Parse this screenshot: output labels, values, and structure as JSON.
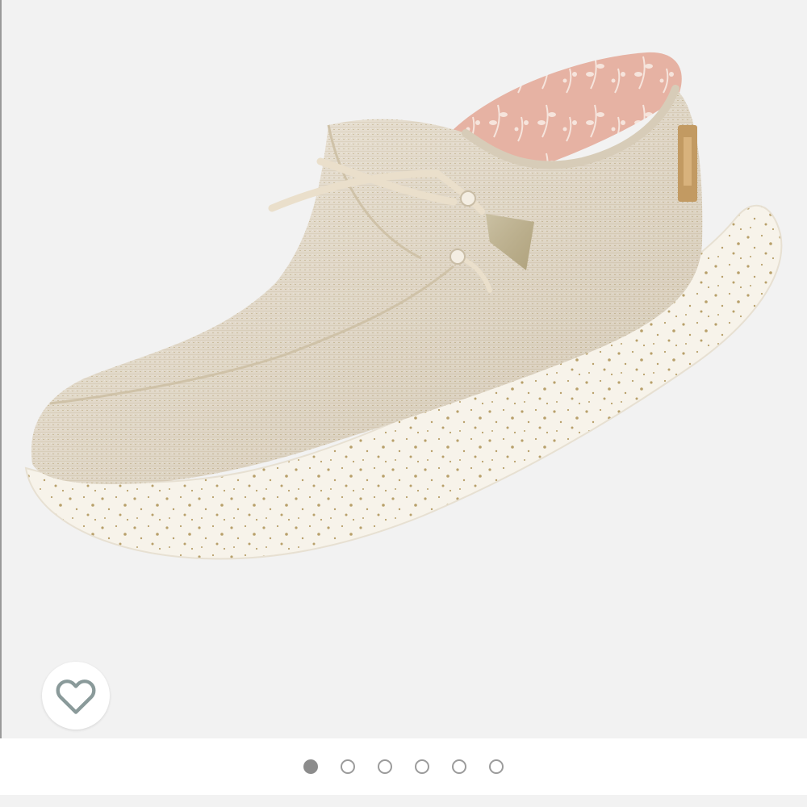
{
  "gallery": {
    "image_alt": "shoe-product-photo",
    "total_images": 6,
    "active_index": 0
  },
  "favorite": {
    "icon": "heart-outline-icon"
  },
  "colors": {
    "background": "#f2f2f2",
    "canvas": "#efe6d8",
    "sole": "#f6f3ec",
    "speckle": "#b8a06a",
    "lining": "#e8b5a6",
    "dot_active": "#8c8c8c",
    "dot_inactive": "#9b9b9b"
  }
}
